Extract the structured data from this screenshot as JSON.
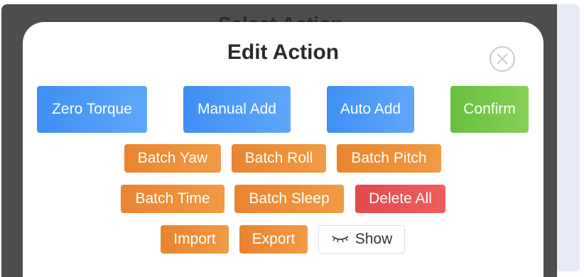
{
  "background": {
    "title": "Select Action"
  },
  "modal": {
    "title": "Edit Action",
    "buttons": {
      "zero_torque": "Zero Torque",
      "manual_add": "Manual Add",
      "auto_add": "Auto Add",
      "confirm": "Confirm",
      "batch_yaw": "Batch Yaw",
      "batch_roll": "Batch Roll",
      "batch_pitch": "Batch Pitch",
      "batch_time": "Batch Time",
      "batch_sleep": "Batch Sleep",
      "delete_all": "Delete All",
      "import": "Import",
      "export": "Export",
      "show": "Show"
    }
  },
  "colors": {
    "primary": "#4a98f7",
    "success": "#76c84a",
    "warning": "#ee8f3a",
    "danger": "#e95353"
  }
}
